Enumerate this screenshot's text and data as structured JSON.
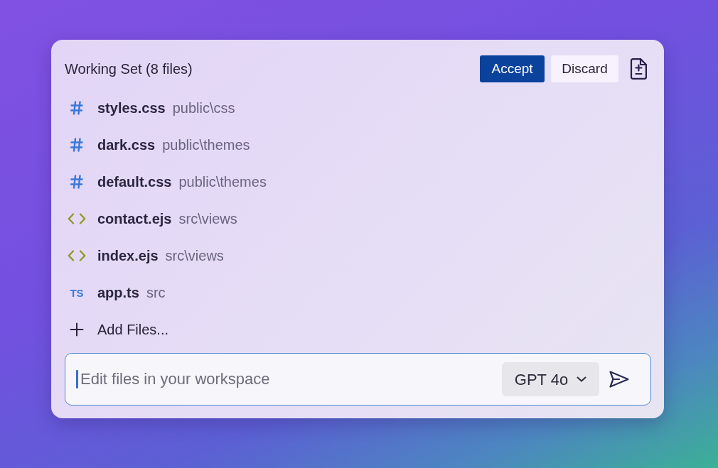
{
  "panel": {
    "title": "Working Set (8 files)",
    "buttons": [
      {
        "label": "Accept",
        "kind": "primary"
      },
      {
        "label": "Discard",
        "kind": "secondary"
      }
    ]
  },
  "files": [
    {
      "kind": "css",
      "name": "styles.css",
      "path": "public\\css"
    },
    {
      "kind": "css",
      "name": "dark.css",
      "path": "public\\themes"
    },
    {
      "kind": "css",
      "name": "default.css",
      "path": "public\\themes"
    },
    {
      "kind": "ejs",
      "name": "contact.ejs",
      "path": "src\\views"
    },
    {
      "kind": "ejs",
      "name": "index.ejs",
      "path": "src\\views"
    },
    {
      "kind": "ts",
      "icon_text": "TS",
      "name": "app.ts",
      "path": "src"
    }
  ],
  "add_files": {
    "label": "Add Files..."
  },
  "chat_input": {
    "placeholder": "Edit files in your workspace",
    "model": "GPT 4o"
  }
}
